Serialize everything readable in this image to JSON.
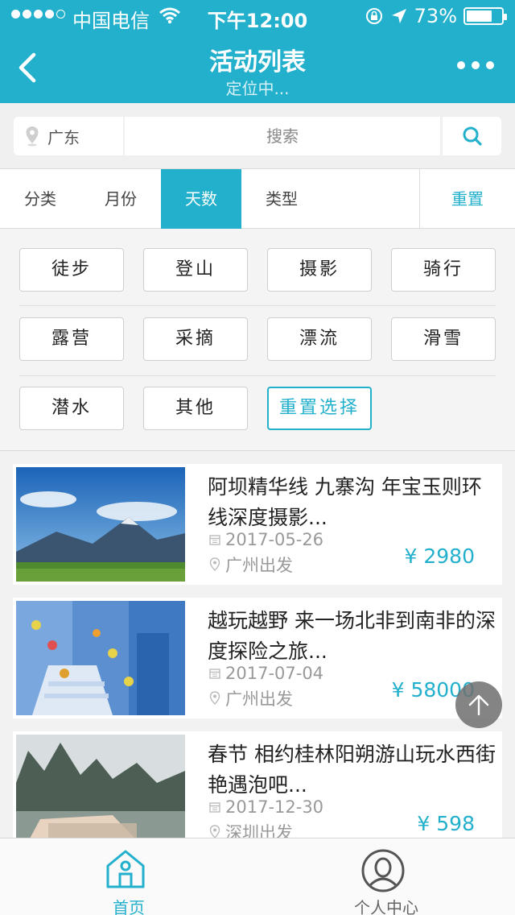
{
  "status_bar": {
    "carrier": "中国电信",
    "time": "下午12:00",
    "battery": "73%",
    "battery_level": 0.73,
    "signal_bars_filled": 4,
    "signal_bars_total": 5
  },
  "nav": {
    "title": "活动列表",
    "subtitle": "定位中..."
  },
  "search": {
    "location": "广东",
    "placeholder": "搜索"
  },
  "filter_tabs": [
    {
      "label": "分类"
    },
    {
      "label": "月份"
    },
    {
      "label": "天数",
      "active": true
    },
    {
      "label": "类型"
    }
  ],
  "reset_label": "重置",
  "options": [
    "徒步",
    "登山",
    "摄影",
    "骑行",
    "露营",
    "采摘",
    "漂流",
    "滑雪",
    "潜水",
    "其他"
  ],
  "reset_selection_label": "重置选择",
  "activities": [
    {
      "title": "阿坝精华线 九寨沟 年宝玉则环线深度摄影...",
      "date": "2017-05-26",
      "depart": "广州出发",
      "price": "¥ 2980"
    },
    {
      "title": "越玩越野 来一场北非到南非的深度探险之旅...",
      "date": "2017-07-04",
      "depart": "广州出发",
      "price": "¥ 58000"
    },
    {
      "title": "春节 相约桂林阳朔游山玩水西街艳遇泡吧...",
      "date": "2017-12-30",
      "depart": "深圳出发",
      "price": "¥ 598"
    }
  ],
  "tabbar": [
    {
      "label": "首页",
      "active": true
    },
    {
      "label": "个人中心"
    }
  ],
  "colors": {
    "brand": "#22b0cc",
    "tab_inactive": "#666666"
  }
}
